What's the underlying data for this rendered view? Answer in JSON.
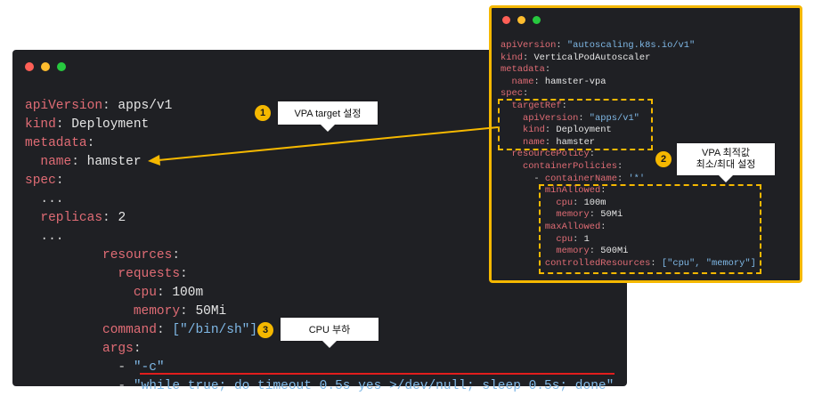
{
  "left_code": [
    [
      [
        "k",
        "apiVersion"
      ],
      [
        "p",
        ": "
      ],
      [
        "w",
        "apps/v1"
      ]
    ],
    [
      [
        "k",
        "kind"
      ],
      [
        "p",
        ": "
      ],
      [
        "w",
        "Deployment"
      ]
    ],
    [
      [
        "k",
        "metadata"
      ],
      [
        "p",
        ":"
      ]
    ],
    [
      [
        "p",
        "  "
      ],
      [
        "k",
        "name"
      ],
      [
        "p",
        ": "
      ],
      [
        "w",
        "hamster"
      ]
    ],
    [
      [
        "k",
        "spec"
      ],
      [
        "p",
        ":"
      ]
    ],
    [
      [
        "p",
        "  ..."
      ]
    ],
    [
      [
        "p",
        "  "
      ],
      [
        "k",
        "replicas"
      ],
      [
        "p",
        ": "
      ],
      [
        "w",
        "2"
      ]
    ],
    [
      [
        "p",
        "  ..."
      ]
    ],
    [
      [
        "p",
        "          "
      ],
      [
        "k",
        "resources"
      ],
      [
        "p",
        ":"
      ]
    ],
    [
      [
        "p",
        "            "
      ],
      [
        "k",
        "requests"
      ],
      [
        "p",
        ":"
      ]
    ],
    [
      [
        "p",
        "              "
      ],
      [
        "k",
        "cpu"
      ],
      [
        "p",
        ": "
      ],
      [
        "w",
        "100m"
      ]
    ],
    [
      [
        "p",
        "              "
      ],
      [
        "k",
        "memory"
      ],
      [
        "p",
        ": "
      ],
      [
        "w",
        "50Mi"
      ]
    ],
    [
      [
        "p",
        "          "
      ],
      [
        "k",
        "command"
      ],
      [
        "p",
        ": "
      ],
      [
        "s",
        "[\"/bin/sh\"]"
      ]
    ],
    [
      [
        "p",
        "          "
      ],
      [
        "k",
        "args"
      ],
      [
        "p",
        ":"
      ]
    ],
    [
      [
        "p",
        "            - "
      ],
      [
        "s",
        "\"-c\""
      ]
    ],
    [
      [
        "p",
        "            - "
      ],
      [
        "s",
        "\"while true; do timeout 0.5s yes >/dev/null; sleep 0.5s; done\""
      ]
    ]
  ],
  "right_code": [
    [
      [
        "k",
        "apiVersion"
      ],
      [
        "p",
        ": "
      ],
      [
        "s",
        "\"autoscaling.k8s.io/v1\""
      ]
    ],
    [
      [
        "k",
        "kind"
      ],
      [
        "p",
        ": "
      ],
      [
        "w",
        "VerticalPodAutoscaler"
      ]
    ],
    [
      [
        "k",
        "metadata"
      ],
      [
        "p",
        ":"
      ]
    ],
    [
      [
        "p",
        "  "
      ],
      [
        "k",
        "name"
      ],
      [
        "p",
        ": "
      ],
      [
        "w",
        "hamster-vpa"
      ]
    ],
    [
      [
        "k",
        "spec"
      ],
      [
        "p",
        ":"
      ]
    ],
    [
      [
        "p",
        "  "
      ],
      [
        "k",
        "targetRef"
      ],
      [
        "p",
        ":"
      ]
    ],
    [
      [
        "p",
        "    "
      ],
      [
        "k",
        "apiVersion"
      ],
      [
        "p",
        ": "
      ],
      [
        "s",
        "\"apps/v1\""
      ]
    ],
    [
      [
        "p",
        "    "
      ],
      [
        "k",
        "kind"
      ],
      [
        "p",
        ": "
      ],
      [
        "w",
        "Deployment"
      ]
    ],
    [
      [
        "p",
        "    "
      ],
      [
        "k",
        "name"
      ],
      [
        "p",
        ": "
      ],
      [
        "w",
        "hamster"
      ]
    ],
    [
      [
        "p",
        "  "
      ],
      [
        "k",
        "resourcePolicy"
      ],
      [
        "p",
        ":"
      ]
    ],
    [
      [
        "p",
        "    "
      ],
      [
        "k",
        "containerPolicies"
      ],
      [
        "p",
        ":"
      ]
    ],
    [
      [
        "p",
        "      - "
      ],
      [
        "k",
        "containerName"
      ],
      [
        "p",
        ": "
      ],
      [
        "s",
        "'*'"
      ]
    ],
    [
      [
        "p",
        "        "
      ],
      [
        "k",
        "minAllowed"
      ],
      [
        "p",
        ":"
      ]
    ],
    [
      [
        "p",
        "          "
      ],
      [
        "k",
        "cpu"
      ],
      [
        "p",
        ": "
      ],
      [
        "w",
        "100m"
      ]
    ],
    [
      [
        "p",
        "          "
      ],
      [
        "k",
        "memory"
      ],
      [
        "p",
        ": "
      ],
      [
        "w",
        "50Mi"
      ]
    ],
    [
      [
        "p",
        "        "
      ],
      [
        "k",
        "maxAllowed"
      ],
      [
        "p",
        ":"
      ]
    ],
    [
      [
        "p",
        "          "
      ],
      [
        "k",
        "cpu"
      ],
      [
        "p",
        ": "
      ],
      [
        "w",
        "1"
      ]
    ],
    [
      [
        "p",
        "          "
      ],
      [
        "k",
        "memory"
      ],
      [
        "p",
        ": "
      ],
      [
        "w",
        "500Mi"
      ]
    ],
    [
      [
        "p",
        "        "
      ],
      [
        "k",
        "controlledResources"
      ],
      [
        "p",
        ": "
      ],
      [
        "s",
        "[\"cpu\", \"memory\"]"
      ]
    ]
  ],
  "callouts": {
    "one": {
      "number": "1",
      "text": "VPA target 설정"
    },
    "two": {
      "number": "2",
      "text_line1": "VPA 최적값",
      "text_line2": "최소/최대 설정"
    },
    "three": {
      "number": "3",
      "text": "CPU 부하"
    }
  },
  "colors": {
    "accent": "#f5b800",
    "arrow": "#f5b800",
    "underline": "#e11d1d",
    "key": "#e06c75",
    "string": "#7fb8e6"
  }
}
